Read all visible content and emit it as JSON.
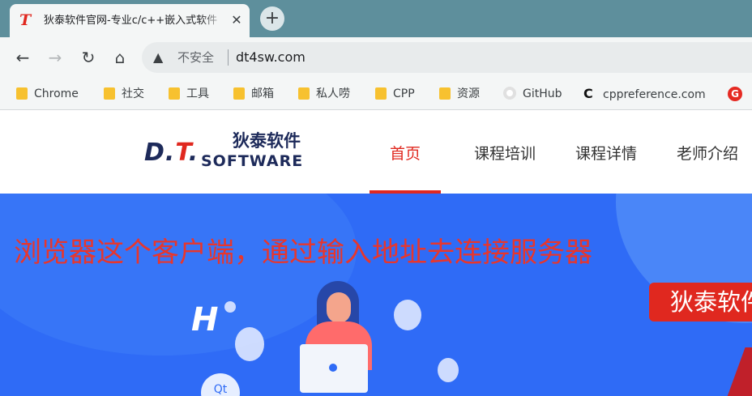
{
  "browser": {
    "tab": {
      "title": "狄泰软件官网-专业c/c++嵌入式软件",
      "close_glyph": "✕",
      "favicon_text": "T"
    },
    "new_tab_glyph": "+",
    "nav": {
      "back": "←",
      "forward": "→",
      "reload": "↻",
      "home": "⌂"
    },
    "omnibox": {
      "security_label": "不安全",
      "url": "dt4sw.com",
      "warn_glyph": "▲"
    },
    "bookmarks": [
      {
        "label": "Chrome",
        "icon": "folder-icon"
      },
      {
        "label": "社交",
        "icon": "folder-icon"
      },
      {
        "label": "工具",
        "icon": "folder-icon"
      },
      {
        "label": "邮箱",
        "icon": "folder-icon"
      },
      {
        "label": "私人唠",
        "icon": "folder-icon"
      },
      {
        "label": "CPP",
        "icon": "folder-icon"
      },
      {
        "label": "资源",
        "icon": "folder-icon"
      },
      {
        "label": "GitHub",
        "icon": "github-icon"
      },
      {
        "label": "cppreference.com",
        "icon": "cppreference-icon"
      },
      {
        "label": "",
        "icon": "red-g-icon"
      }
    ]
  },
  "site": {
    "logo": {
      "dt_prefix": "D.",
      "dt_t": "T",
      "dt_suffix": ".",
      "cn": "狄泰软件",
      "en": "SOFTWARE"
    },
    "nav": [
      {
        "label": "首页",
        "active": true
      },
      {
        "label": "课程培训",
        "active": false
      },
      {
        "label": "课程详情",
        "active": false
      },
      {
        "label": "老师介绍",
        "active": false
      }
    ],
    "banner": {
      "headline": "浏览器这个客户端，通过输入地址去连接服务器",
      "brand_tag": "狄泰软件",
      "qt_label": "Qt"
    }
  },
  "colors": {
    "accent": "#e0281f",
    "banner_bg": "#2f6bf6",
    "tab_strip": "#5e8f9c"
  }
}
